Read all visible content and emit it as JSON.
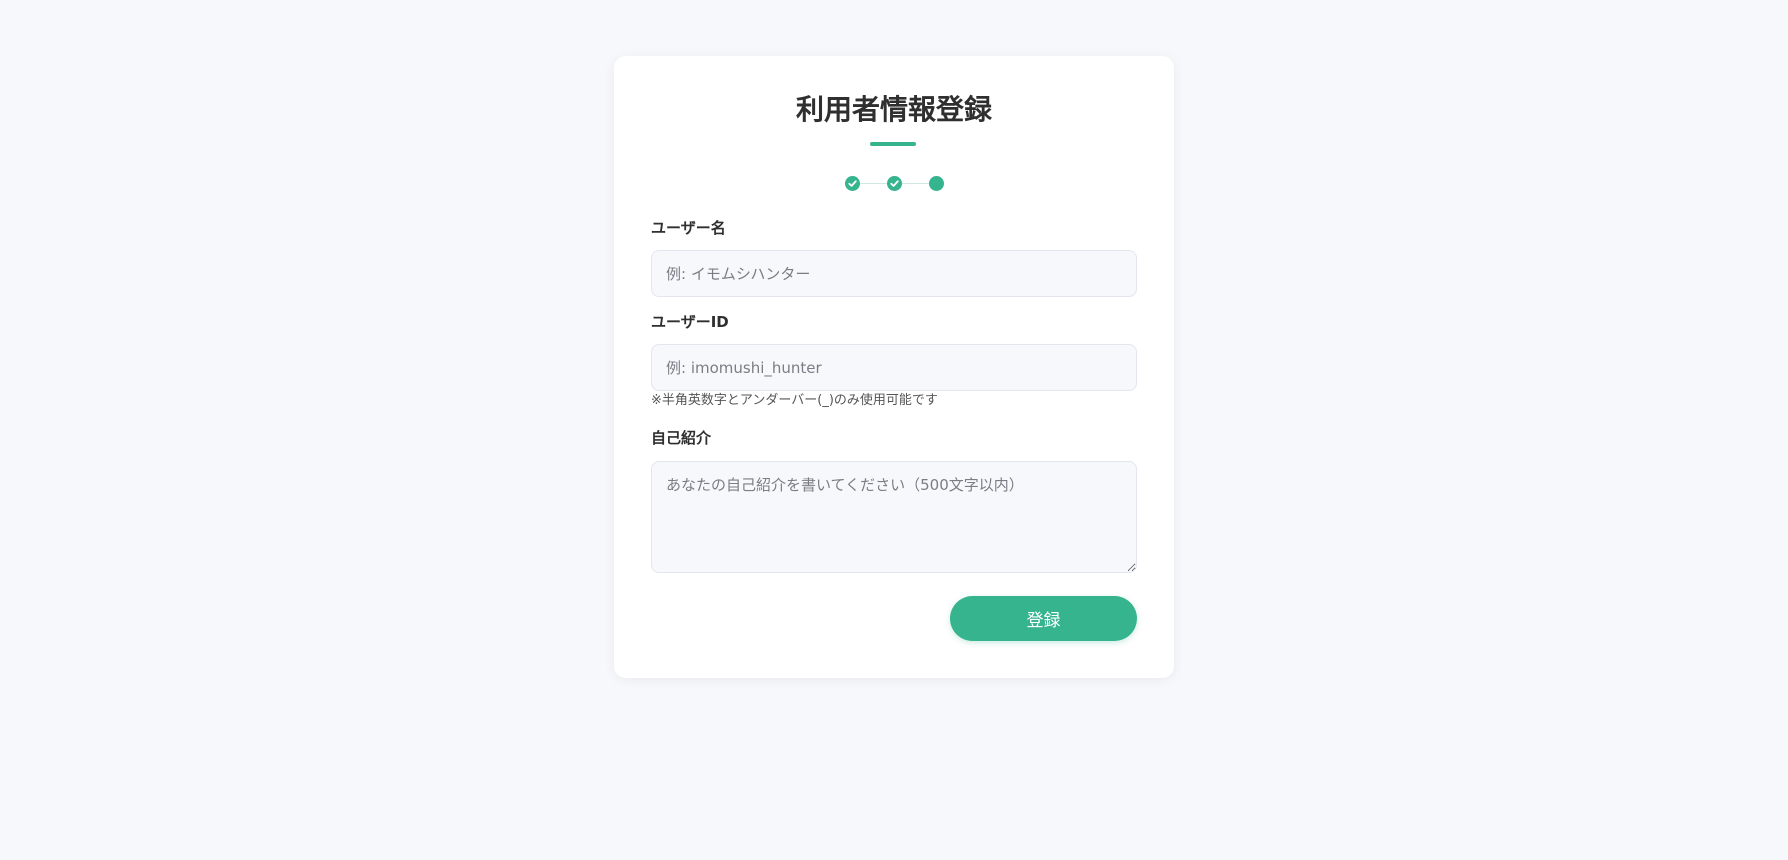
{
  "form": {
    "title": "利用者情報登録",
    "steps": [
      {
        "state": "done",
        "icon": "check-icon"
      },
      {
        "state": "done",
        "icon": "check-icon"
      },
      {
        "state": "current",
        "icon": "dot-icon"
      }
    ],
    "username": {
      "label": "ユーザー名",
      "placeholder": "例: イモムシハンター",
      "value": ""
    },
    "user_id": {
      "label": "ユーザーID",
      "placeholder": "例: imomushi_hunter",
      "value": "",
      "hint": "※半角英数字とアンダーバー(_)のみ使用可能です"
    },
    "bio": {
      "label": "自己紹介",
      "placeholder": "あなたの自己紹介を書いてください（500文字以内）",
      "value": ""
    },
    "submit_label": "登録"
  },
  "colors": {
    "accent": "#36b48e",
    "page_background": "#f7f8fc",
    "card_background": "#ffffff"
  }
}
